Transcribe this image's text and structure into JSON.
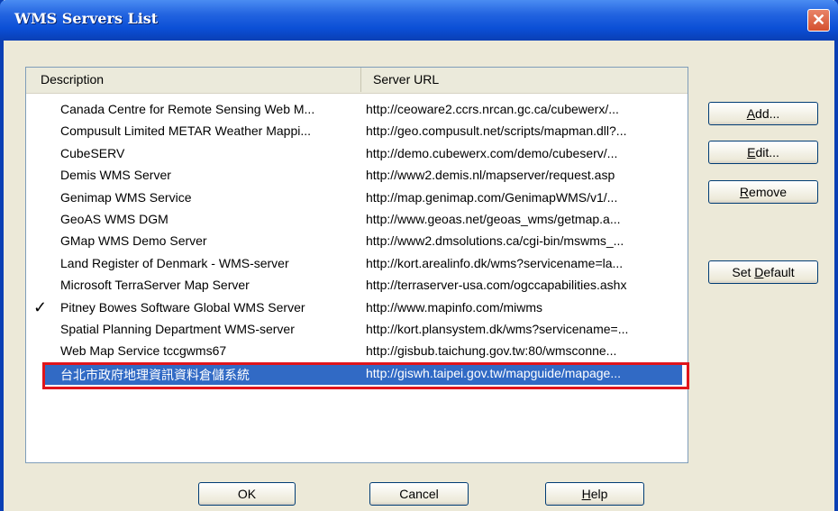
{
  "window": {
    "title": "WMS Servers List",
    "close_glyph": "✕"
  },
  "list": {
    "columns": {
      "description": "Description",
      "url": "Server URL"
    },
    "default_marker": "✓",
    "rows": [
      {
        "description": "Canada Centre for Remote Sensing Web M...",
        "url": "http://ceoware2.ccrs.nrcan.gc.ca/cubewerx/...",
        "default": false,
        "selected": false
      },
      {
        "description": "Compusult Limited METAR Weather Mappi...",
        "url": "http://geo.compusult.net/scripts/mapman.dll?...",
        "default": false,
        "selected": false
      },
      {
        "description": "CubeSERV",
        "url": "http://demo.cubewerx.com/demo/cubeserv/...",
        "default": false,
        "selected": false
      },
      {
        "description": "Demis WMS Server",
        "url": "http://www2.demis.nl/mapserver/request.asp",
        "default": false,
        "selected": false
      },
      {
        "description": "Genimap WMS Service",
        "url": "http://map.genimap.com/GenimapWMS/v1/...",
        "default": false,
        "selected": false
      },
      {
        "description": "GeoAS WMS DGM",
        "url": "http://www.geoas.net/geoas_wms/getmap.a...",
        "default": false,
        "selected": false
      },
      {
        "description": "GMap WMS Demo Server",
        "url": "http://www2.dmsolutions.ca/cgi-bin/mswms_...",
        "default": false,
        "selected": false
      },
      {
        "description": "Land Register of Denmark - WMS-server",
        "url": "http://kort.arealinfo.dk/wms?servicename=la...",
        "default": false,
        "selected": false
      },
      {
        "description": "Microsoft TerraServer Map Server",
        "url": "http://terraserver-usa.com/ogccapabilities.ashx",
        "default": false,
        "selected": false
      },
      {
        "description": "Pitney Bowes Software Global WMS Server",
        "url": "http://www.mapinfo.com/miwms",
        "default": true,
        "selected": false
      },
      {
        "description": "Spatial Planning Department WMS-server",
        "url": "http://kort.plansystem.dk/wms?servicename=...",
        "default": false,
        "selected": false
      },
      {
        "description": "Web Map Service tccgwms67",
        "url": "http://gisbub.taichung.gov.tw:80/wmsconne...",
        "default": false,
        "selected": false
      },
      {
        "description": "台北市政府地理資訊資料倉儲系統",
        "url": "http://giswh.taipei.gov.tw/mapguide/mapage...",
        "default": false,
        "selected": true
      }
    ]
  },
  "side_buttons": {
    "add": {
      "hot": "A",
      "rest": "dd..."
    },
    "edit": {
      "hot": "E",
      "rest": "dit..."
    },
    "remove": {
      "hot": "R",
      "rest": "emove"
    },
    "set_default": {
      "pre": "Set ",
      "hot": "D",
      "rest": "efault"
    }
  },
  "bottom_buttons": {
    "ok": "OK",
    "cancel": "Cancel",
    "help": {
      "hot": "H",
      "rest": "elp"
    }
  },
  "colors": {
    "title_bar": "#0a3fb4",
    "selection": "#316ac5",
    "annotation": "#e0151b"
  }
}
